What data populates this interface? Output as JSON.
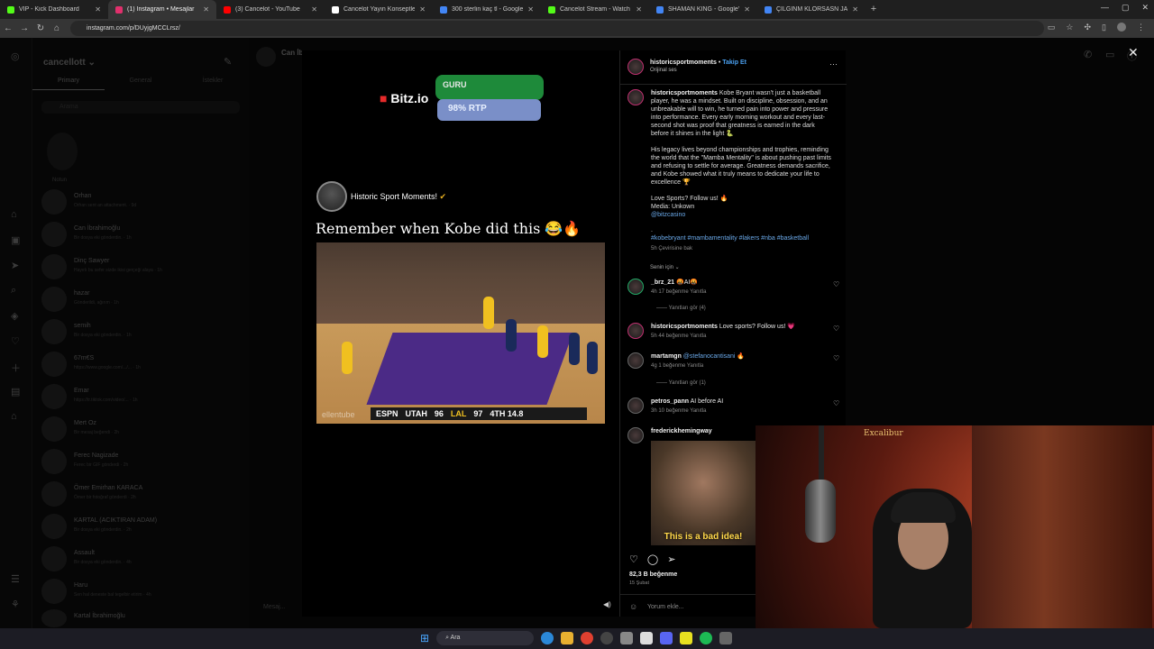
{
  "browser": {
    "tabs": [
      {
        "label": "VIP - Kick Dashboard",
        "color": "#53fc18"
      },
      {
        "label": "(1) Instagram • Mesajlar",
        "color": "#e1306c",
        "active": true
      },
      {
        "label": "(3) Cancelot - YouTube",
        "color": "#ff0000"
      },
      {
        "label": "Cancelot Yayın Konseptleri",
        "color": "#ffffff"
      },
      {
        "label": "300 sterlin kaç tl - Google'da Ar",
        "color": "#4285f4"
      },
      {
        "label": "Cancelot Stream - Watch Live o",
        "color": "#53fc18"
      },
      {
        "label": "SHAMAN KING - Google'da Ara",
        "color": "#4285f4"
      },
      {
        "label": "ÇILGINM KLORSASN JACK - Go",
        "color": "#4285f4"
      }
    ],
    "new_tab": "+",
    "url": "instagram.com/p/DUyjgMCCLrsz/"
  },
  "inbox": {
    "username": "cancellott ⌄",
    "tabs": [
      "Primary",
      "General",
      "İstekler"
    ],
    "search_placeholder": "Arama",
    "note": "Notun",
    "conversations": [
      {
        "name": "Orhan",
        "preview": "Orhan sent an attachment. · 9d"
      },
      {
        "name": "Can İbrahimoğlu",
        "preview": "Bir dosya eki gönderdin. · 1h"
      },
      {
        "name": "Dinç Sawyer",
        "preview": "Hayırlı bu sefer sizde ikisi gerçeği alaya · 1h"
      },
      {
        "name": "hazar",
        "preview": "Gönderildi, ağırım · 1h"
      },
      {
        "name": "semih",
        "preview": "Bir dosya eki gönderdin. · 1h"
      },
      {
        "name": "67m€S",
        "preview": "https://www.google.com/.../... · 1h"
      },
      {
        "name": "Emar",
        "preview": "https://tr.tiktok.com/video/... · 1h"
      },
      {
        "name": "Mert Oz",
        "preview": "Bir mesaj beğendi · 2h"
      },
      {
        "name": "Ferec Nagizade",
        "preview": "Ferec bir GIF gönderdi · 2h"
      },
      {
        "name": "Ömer Emirhan KARACA",
        "preview": "Ömer bir fotoğraf gönderdi · 2h"
      },
      {
        "name": "KARTAL (ACIKTIRAN ADAM)",
        "preview": "Bir dosya eki gönderdin. · 2h"
      },
      {
        "name": "Assault",
        "preview": "Bir dosya eki gönderdin. · 4h"
      },
      {
        "name": "Haru",
        "preview": "Sen hal deneste bal tegelbir etirim · 4h"
      },
      {
        "name": "Kartal İbrahimoğlu",
        "preview": "Bir dosya eki gönderdin"
      }
    ],
    "chat_name": "Can İb",
    "message_placeholder": "Mesaj..."
  },
  "post": {
    "overlay_brand": "Bitz.io",
    "guru_label": "GURU",
    "rtp_label": "98% RTP",
    "repost_account": "Historic Sport Moments!",
    "caption_title": "Remember when Kobe did this 😂🔥",
    "scoreboard": {
      "network": "ESPN",
      "team1": "UTAH",
      "score1": "96",
      "team2": "LAL",
      "score2": "97",
      "clock": "4TH 14.8"
    },
    "watermark": "ellentube"
  },
  "side": {
    "author": "historicsportmoments",
    "follow": "Takip Et",
    "audio": "Orijinal ses",
    "more": "···",
    "caption_p1": "Kobe Bryant wasn't just a basketball player, he was a mindset. Built on discipline, obsession, and an unbreakable will to win, he turned pain into power and pressure into performance. Every early morning workout and every last-second shot was proof that greatness is earned in the dark before it shines in the light 🐍",
    "caption_p2": "His legacy lives beyond championships and trophies, reminding the world that the \"Mamba Mentality\" is about pushing past limits and refusing to settle for average. Greatness demands sacrifice, and Kobe showed what it truly means to dedicate your life to excellence 🏆",
    "caption_p3": "Love Sports? Follow us! 🔥",
    "caption_p4": "Media: Unkown",
    "caption_mention": "@bitzcasino",
    "caption_dot": ".",
    "hashtags": "#kobebryant #mambamentality #lakers #nba #basketball",
    "caption_meta": "5h   Çevirisine bak",
    "for_you": "Senin için ⌄",
    "comments": [
      {
        "user": "_brz_21",
        "text": "🤬AI🤬",
        "meta": "4h   17 beğenme   Yanıtla",
        "replies": "Yanıtları gör (4)"
      },
      {
        "user": "historicsportmoments",
        "text": "Love sports? Follow us! 💗",
        "meta": "5h   44 beğenme   Yanıtla"
      },
      {
        "user": "martamgn",
        "text": "@stefanocantisani 🔥",
        "meta": "4g   1 beğenme   Yanıtla",
        "replies": "Yanıtları gör (1)"
      },
      {
        "user": "petros_pann",
        "text": "AI before AI",
        "meta": "3h   10 beğenme   Yanıtla"
      },
      {
        "user": "frederickhemingway",
        "text": ""
      }
    ],
    "gif_caption": "This is a bad idea!",
    "likes": "82,3 B beğenme",
    "date": "15 Şubat",
    "add_comment": "Yorum ekle..."
  },
  "webcam": {
    "sign": "Excalibur"
  },
  "taskbar": {
    "search": "Ara"
  }
}
